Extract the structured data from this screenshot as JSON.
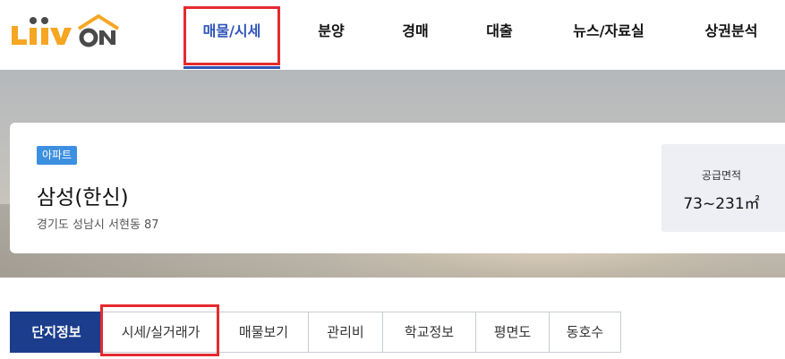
{
  "brand": {
    "logo_text_left": "Liiv",
    "logo_text_right": "ON",
    "logo_primary_color": "#f5a623",
    "logo_secondary_color": "#4a4a4a"
  },
  "nav": {
    "items": [
      {
        "label": "매물/시세",
        "active": true
      },
      {
        "label": "분양",
        "active": false
      },
      {
        "label": "경매",
        "active": false
      },
      {
        "label": "대출",
        "active": false
      },
      {
        "label": "뉴스/자료실",
        "active": false
      },
      {
        "label": "상권분석",
        "active": false
      }
    ],
    "active_color": "#2f54b9"
  },
  "property": {
    "badge": "아파트",
    "name": "삼성(한신)",
    "address": "경기도 성남시 서현동 87",
    "area_label": "공급면적",
    "area_value": "73~231㎡"
  },
  "tabs": {
    "items": [
      {
        "label": "단지정보",
        "active": true
      },
      {
        "label": "시세/실거래가",
        "active": false
      },
      {
        "label": "매물보기",
        "active": false
      },
      {
        "label": "관리비",
        "active": false
      },
      {
        "label": "학교정보",
        "active": false
      },
      {
        "label": "평면도",
        "active": false
      },
      {
        "label": "동호수",
        "active": false
      }
    ],
    "active_color": "#1b3d8c"
  },
  "highlight_color": "#e52a2f"
}
